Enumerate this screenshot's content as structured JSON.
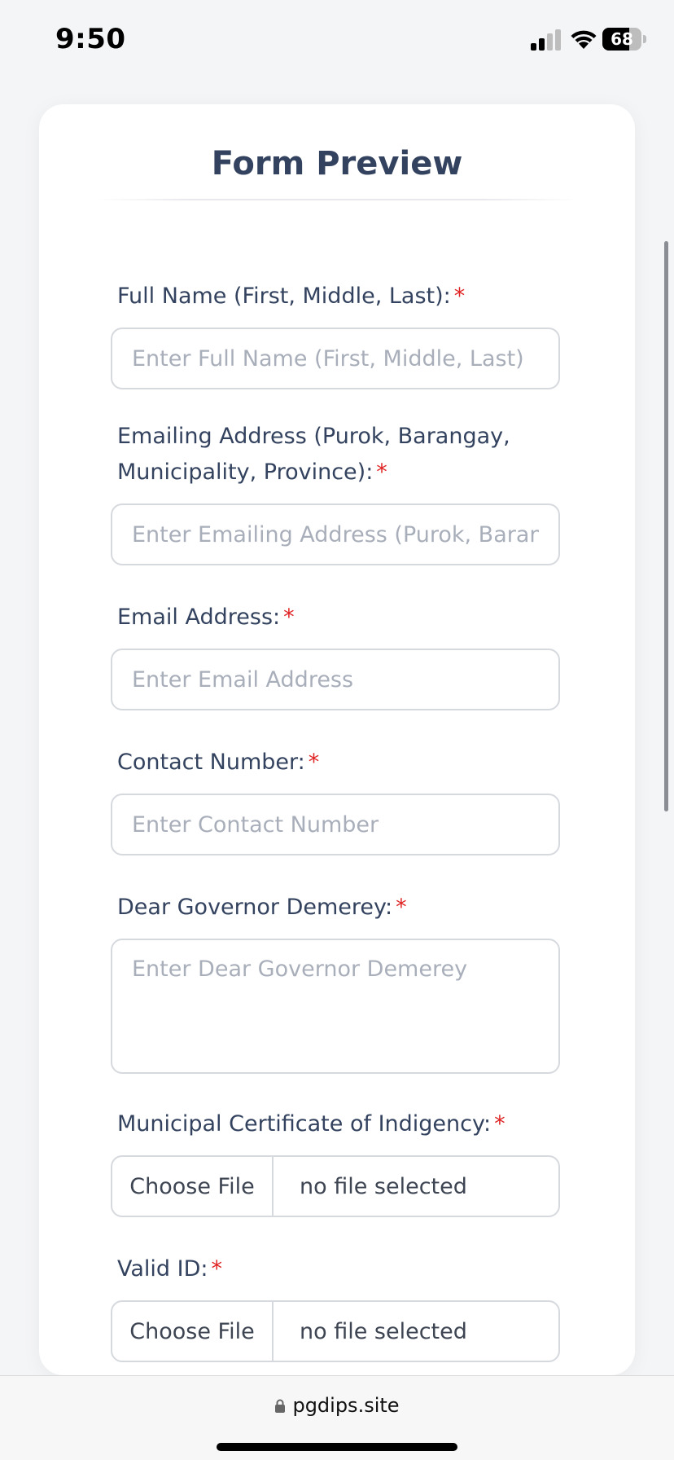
{
  "status_bar": {
    "time": "9:50",
    "battery_level": "68",
    "battery_fraction": 0.68
  },
  "form": {
    "title": "Form Preview",
    "fields": [
      {
        "label": "Full Name (First, Middle, Last):",
        "placeholder": "Enter Full Name (First, Middle, Last)",
        "value": ""
      },
      {
        "label": "Emailing Address (Purok, Barangay, Municipality, Province):",
        "placeholder": "Enter Emailing Address (Purok, Barangay, Municipality, Province)",
        "value": ""
      },
      {
        "label": "Email Address:",
        "placeholder": "Enter Email Address",
        "value": ""
      },
      {
        "label": "Contact Number:",
        "placeholder": "Enter Contact Number",
        "value": ""
      },
      {
        "label": "Dear Governor Demerey:",
        "placeholder": "Enter Dear Governor Demerey",
        "value": ""
      }
    ],
    "file_fields": [
      {
        "label": "Municipal Certificate of Indigency:",
        "button_label": "Choose File",
        "status": "no file selected"
      },
      {
        "label": "Valid ID:",
        "button_label": "Choose File",
        "status": "no file selected"
      }
    ],
    "required_mark": "*"
  },
  "browser": {
    "url": "pgdips.site"
  },
  "icons": {
    "signal": "cellular-signal-icon",
    "wifi": "wifi-icon",
    "battery": "battery-icon",
    "lock": "lock-icon"
  },
  "colors": {
    "title": "#33425e",
    "required": "#e02424",
    "placeholder": "#a9afba",
    "border": "#d6d9de"
  }
}
